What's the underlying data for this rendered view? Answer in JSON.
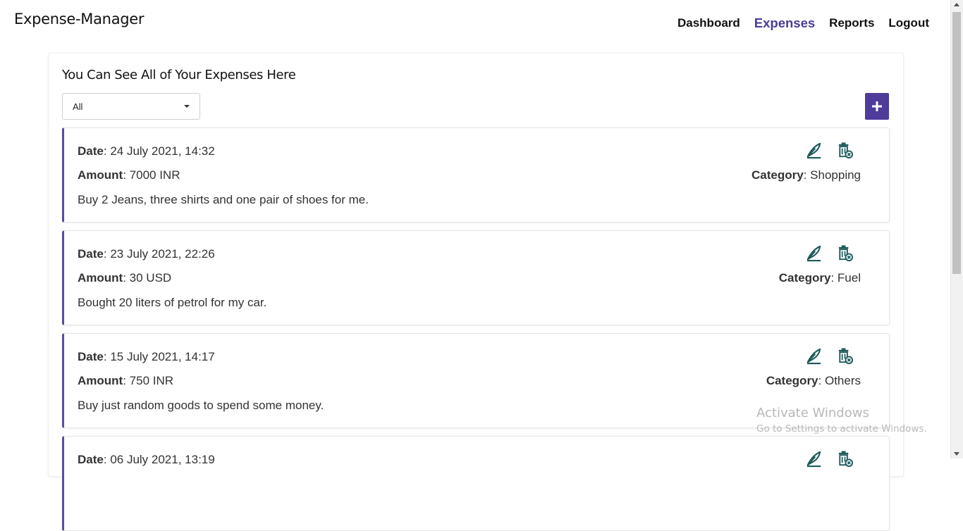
{
  "app": {
    "brand": "Expense-Manager"
  },
  "nav": {
    "links": [
      {
        "label": "Dashboard",
        "active": false
      },
      {
        "label": "Expenses",
        "active": true
      },
      {
        "label": "Reports",
        "active": false
      },
      {
        "label": "Logout",
        "active": false
      }
    ]
  },
  "panel": {
    "title": "You Can See All of Your Expenses Here",
    "filter": {
      "selected": "All"
    },
    "add_button_icon": "plus-icon"
  },
  "labels": {
    "date": "Date",
    "amount": "Amount",
    "category": "Category"
  },
  "expenses": [
    {
      "date": "24 July 2021, 14:32",
      "amount": "7000 INR",
      "category": "Shopping",
      "description": "Buy 2 Jeans, three shirts and one pair of shoes for me."
    },
    {
      "date": "23 July 2021, 22:26",
      "amount": "30 USD",
      "category": "Fuel",
      "description": "Bought 20 liters of petrol for my car."
    },
    {
      "date": "15 July 2021, 14:17",
      "amount": "750 INR",
      "category": "Others",
      "description": "Buy just random goods to spend some money."
    },
    {
      "date": "06 July 2021, 13:19",
      "amount": "",
      "category": "",
      "description": ""
    }
  ],
  "watermark": {
    "line1": "Activate Windows",
    "line2": "Go to Settings to activate Windows."
  },
  "colors": {
    "accent": "#4e3b9a",
    "icon": "#1e5a5a"
  }
}
